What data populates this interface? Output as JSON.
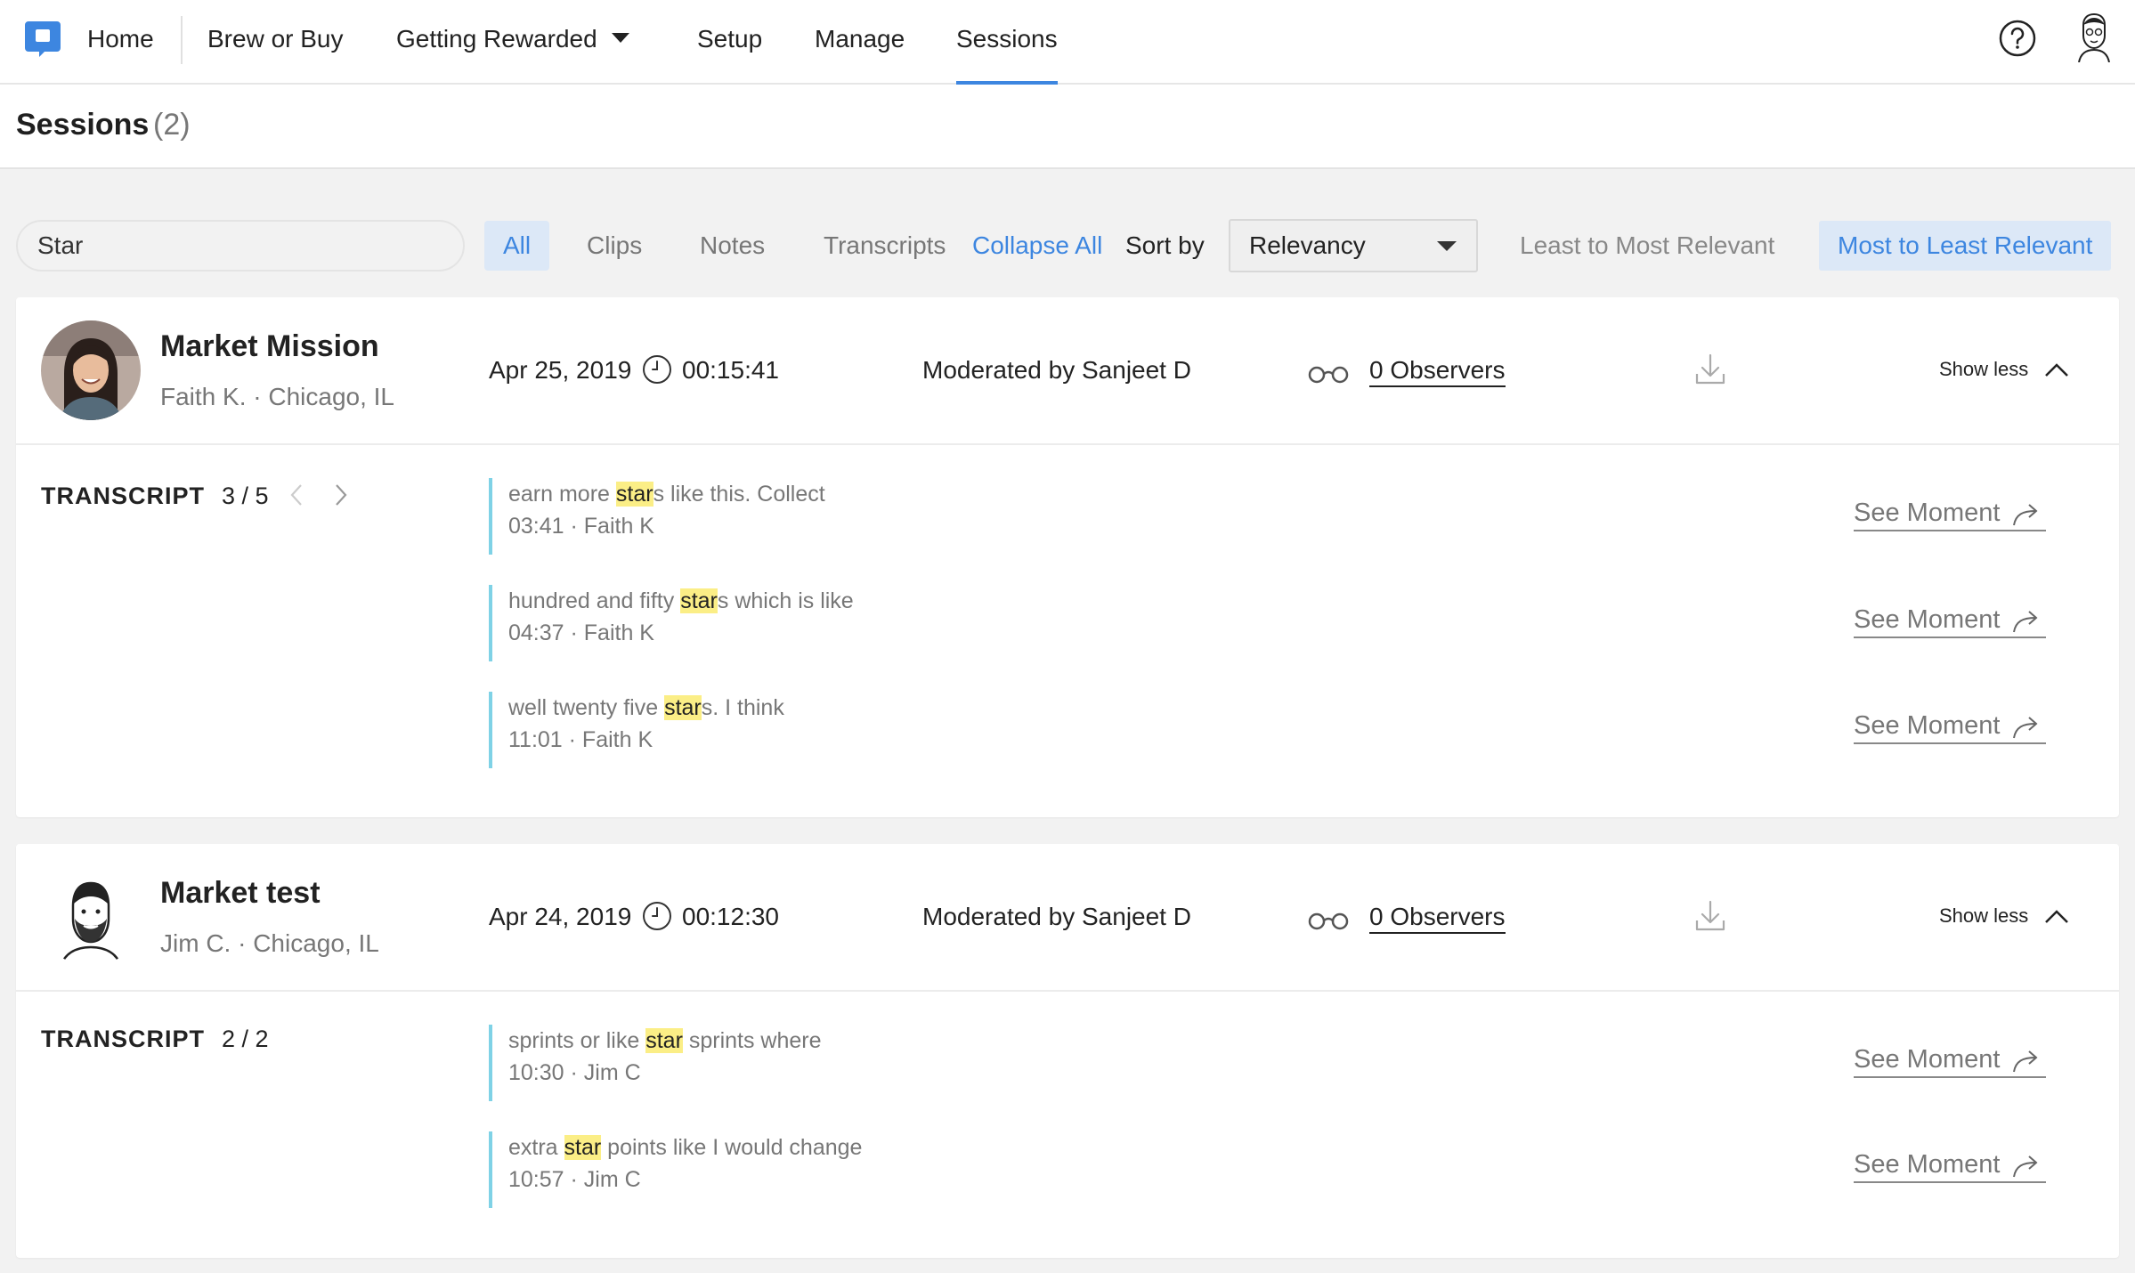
{
  "nav": {
    "items": [
      {
        "label": "Home"
      },
      {
        "label": "Brew or Buy"
      },
      {
        "label": "Getting Rewarded"
      },
      {
        "label": "Setup"
      },
      {
        "label": "Manage"
      },
      {
        "label": "Sessions"
      }
    ],
    "active": "Sessions",
    "accent": "#3d86e0"
  },
  "page": {
    "title": "Sessions",
    "count": "(2)"
  },
  "filters": {
    "search_value": "Star",
    "tabs": [
      {
        "label": "All"
      },
      {
        "label": "Clips"
      },
      {
        "label": "Notes"
      },
      {
        "label": "Transcripts"
      }
    ],
    "active_tab": "All",
    "collapse_all": "Collapse All",
    "sort_by_label": "Sort by",
    "sort_value": "Relevancy",
    "order_options": [
      {
        "label": "Least to Most Relevant"
      },
      {
        "label": "Most to Least Relevant"
      }
    ],
    "active_order": "Most to Least Relevant"
  },
  "sessions": [
    {
      "name": "Market Mission",
      "participant": "Faith K. · Chicago, IL",
      "date": "Apr 25, 2019",
      "duration": "00:15:41",
      "moderated": "Moderated by Sanjeet D",
      "observers": "0 Observers",
      "toggle": "Show less",
      "transcript_label": "TRANSCRIPT",
      "transcript_count": "3 / 5",
      "moments": [
        {
          "pre": "earn more ",
          "hl": "star",
          "post": "s like this. Collect",
          "meta": "03:41 · Faith K",
          "action": "See Moment"
        },
        {
          "pre": "hundred and fifty ",
          "hl": "star",
          "post": "s which is like",
          "meta": "04:37 · Faith K",
          "action": "See Moment"
        },
        {
          "pre": "well twenty five ",
          "hl": "star",
          "post": "s. I think",
          "meta": "11:01 · Faith K",
          "action": "See Moment"
        }
      ]
    },
    {
      "name": "Market test",
      "participant": "Jim C. · Chicago, IL",
      "date": "Apr 24, 2019",
      "duration": "00:12:30",
      "moderated": "Moderated by Sanjeet D",
      "observers": "0 Observers",
      "toggle": "Show less",
      "transcript_label": "TRANSCRIPT",
      "transcript_count": "2 / 2",
      "moments": [
        {
          "pre": "sprints or like ",
          "hl": "star",
          "post": " sprints where",
          "meta": "10:30 · Jim C",
          "action": "See Moment"
        },
        {
          "pre": "extra ",
          "hl": "star",
          "post": " points like I would change",
          "meta": "10:57 · Jim C",
          "action": "See Moment"
        }
      ]
    }
  ],
  "icons": [
    "app-logo-icon",
    "help-icon",
    "user-avatar",
    "clock-icon",
    "glasses-icon",
    "download-icon",
    "chevron-up-icon",
    "chevron-left-icon",
    "chevron-right-icon",
    "share-arrow-icon",
    "caret-down-icon"
  ]
}
